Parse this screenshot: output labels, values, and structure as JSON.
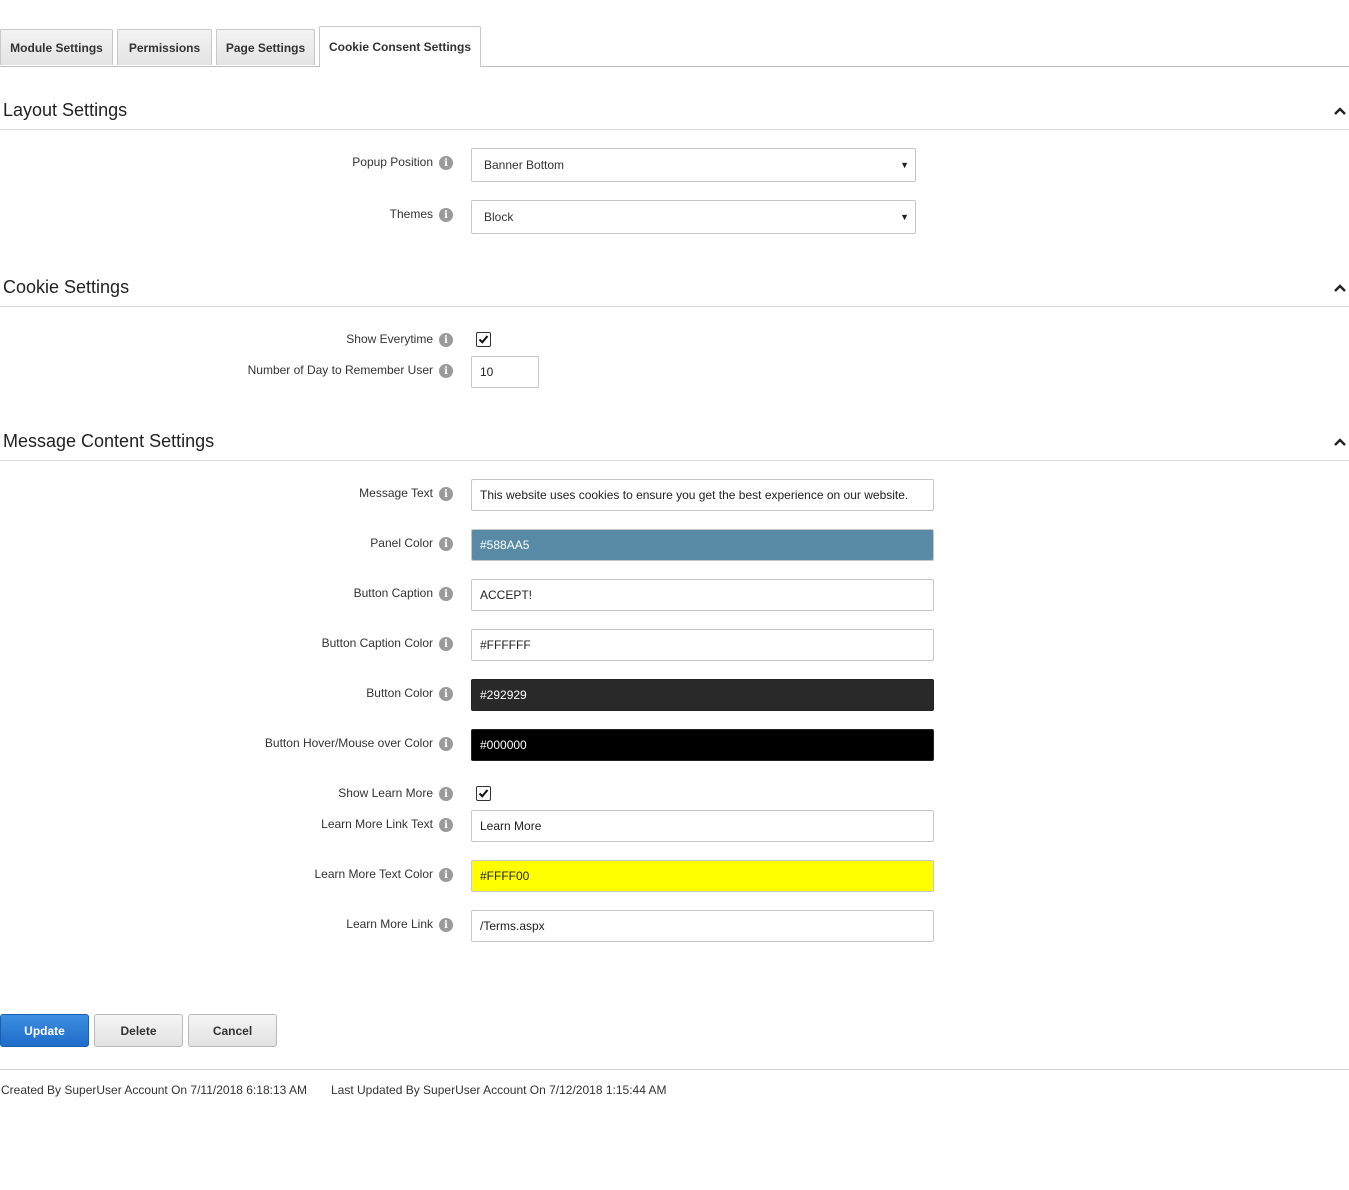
{
  "tabs": [
    {
      "label": "Module Settings"
    },
    {
      "label": "Permissions"
    },
    {
      "label": "Page Settings"
    },
    {
      "label": "Cookie Consent Settings",
      "active": true
    }
  ],
  "sections": {
    "layout": {
      "title": "Layout Settings",
      "popup_position": {
        "label": "Popup Position",
        "value": "Banner Bottom"
      },
      "themes": {
        "label": "Themes",
        "value": "Block"
      }
    },
    "cookie": {
      "title": "Cookie Settings",
      "show_everytime": {
        "label": "Show Everytime",
        "checked": true
      },
      "days_remember": {
        "label": "Number of Day to Remember User",
        "value": "10"
      }
    },
    "message": {
      "title": "Message Content Settings",
      "message_text": {
        "label": "Message Text",
        "value": "This website uses cookies to ensure you get the best experience on our website."
      },
      "panel_color": {
        "label": "Panel Color",
        "value": "#588AA5",
        "bg": "#588AA5",
        "fg": "#ffffff"
      },
      "button_caption": {
        "label": "Button Caption",
        "value": "ACCEPT!"
      },
      "button_caption_color": {
        "label": "Button Caption Color",
        "value": "#FFFFFF",
        "bg": "#ffffff",
        "fg": "#222222"
      },
      "button_color": {
        "label": "Button Color",
        "value": "#292929",
        "bg": "#292929",
        "fg": "#ffffff"
      },
      "button_hover_color": {
        "label": "Button Hover/Mouse over Color",
        "value": "#000000",
        "bg": "#000000",
        "fg": "#ffffff"
      },
      "show_learn_more": {
        "label": "Show Learn More",
        "checked": true
      },
      "learn_more_link_text": {
        "label": "Learn More Link Text",
        "value": "Learn More"
      },
      "learn_more_text_color": {
        "label": "Learn More Text Color",
        "value": "#FFFF00",
        "bg": "#ffff00",
        "fg": "#222222"
      },
      "learn_more_link": {
        "label": "Learn More Link",
        "value": "/Terms.aspx"
      }
    }
  },
  "actions": {
    "update": "Update",
    "delete": "Delete",
    "cancel": "Cancel"
  },
  "footer": {
    "created": "Created By SuperUser Account On 7/11/2018 6:18:13 AM",
    "updated": "Last Updated By SuperUser Account On 7/12/2018 1:15:44 AM"
  },
  "icons": {
    "info": "info-icon",
    "collapse": "chevron-up-icon",
    "dropdown": "dropdown-arrow-icon",
    "check": "checkmark-icon"
  },
  "colors": {
    "primary_button": "#1f6cc9"
  }
}
